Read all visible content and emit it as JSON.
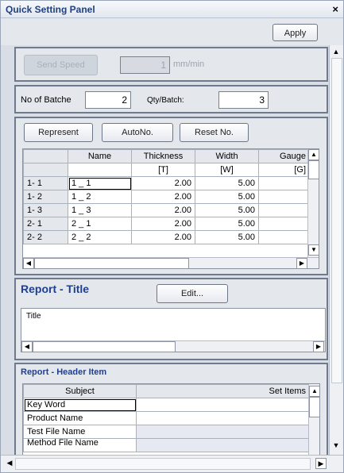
{
  "window": {
    "title": "Quick Setting Panel",
    "close_glyph": "×"
  },
  "toolbar": {
    "apply_label": "Apply"
  },
  "send_speed": {
    "button_label": "Send Speed",
    "value": "1",
    "unit": "mm/min"
  },
  "batch": {
    "no_label": "No of Batche",
    "no_value": "2",
    "qty_label": "Qty/Batch:",
    "qty_value": "3"
  },
  "grid_buttons": {
    "represent": "Represent",
    "autono": "AutoNo.",
    "reset": "Reset No."
  },
  "main_table": {
    "headers": [
      "",
      "Name",
      "Thickness",
      "Width",
      "Gauge"
    ],
    "units": [
      "",
      "",
      "[T]",
      "[W]",
      "[G]"
    ],
    "rows": [
      {
        "id": "1- 1",
        "name": "1 _ 1",
        "thickness": "2.00",
        "width": "5.00"
      },
      {
        "id": "1- 2",
        "name": "1 _ 2",
        "thickness": "2.00",
        "width": "5.00"
      },
      {
        "id": "1- 3",
        "name": "1 _ 3",
        "thickness": "2.00",
        "width": "5.00"
      },
      {
        "id": "2- 1",
        "name": "2 _ 1",
        "thickness": "2.00",
        "width": "5.00"
      },
      {
        "id": "2- 2",
        "name": "2 _ 2",
        "thickness": "2.00",
        "width": "5.00"
      }
    ]
  },
  "report_title": {
    "heading": "Report - Title",
    "edit_label": "Edit...",
    "list_item": "Title"
  },
  "report_header": {
    "heading": "Report - Header Item",
    "col_subject": "Subject",
    "col_set_items": "Set Items",
    "rows": [
      "Key Word",
      "Product Name",
      "Test File Name",
      "Method File Name"
    ]
  },
  "colors": {
    "heading_blue": "#1f3f8f",
    "panel_bg": "#e4e7ec"
  }
}
